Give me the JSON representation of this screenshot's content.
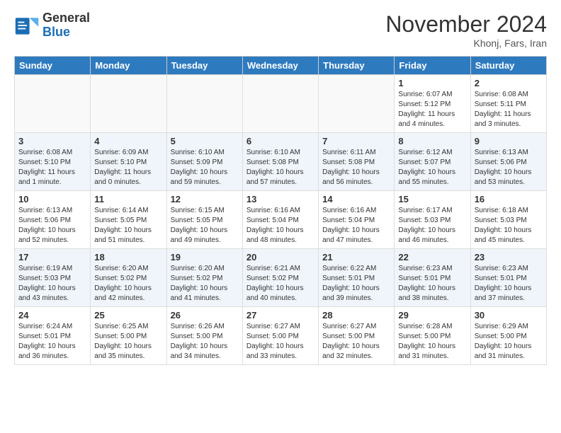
{
  "header": {
    "logo_general": "General",
    "logo_blue": "Blue",
    "month_title": "November 2024",
    "location": "Khonj, Fars, Iran"
  },
  "calendar": {
    "weekdays": [
      "Sunday",
      "Monday",
      "Tuesday",
      "Wednesday",
      "Thursday",
      "Friday",
      "Saturday"
    ],
    "weeks": [
      [
        {
          "day": "",
          "info": ""
        },
        {
          "day": "",
          "info": ""
        },
        {
          "day": "",
          "info": ""
        },
        {
          "day": "",
          "info": ""
        },
        {
          "day": "",
          "info": ""
        },
        {
          "day": "1",
          "info": "Sunrise: 6:07 AM\nSunset: 5:12 PM\nDaylight: 11 hours\nand 4 minutes."
        },
        {
          "day": "2",
          "info": "Sunrise: 6:08 AM\nSunset: 5:11 PM\nDaylight: 11 hours\nand 3 minutes."
        }
      ],
      [
        {
          "day": "3",
          "info": "Sunrise: 6:08 AM\nSunset: 5:10 PM\nDaylight: 11 hours\nand 1 minute."
        },
        {
          "day": "4",
          "info": "Sunrise: 6:09 AM\nSunset: 5:10 PM\nDaylight: 11 hours\nand 0 minutes."
        },
        {
          "day": "5",
          "info": "Sunrise: 6:10 AM\nSunset: 5:09 PM\nDaylight: 10 hours\nand 59 minutes."
        },
        {
          "day": "6",
          "info": "Sunrise: 6:10 AM\nSunset: 5:08 PM\nDaylight: 10 hours\nand 57 minutes."
        },
        {
          "day": "7",
          "info": "Sunrise: 6:11 AM\nSunset: 5:08 PM\nDaylight: 10 hours\nand 56 minutes."
        },
        {
          "day": "8",
          "info": "Sunrise: 6:12 AM\nSunset: 5:07 PM\nDaylight: 10 hours\nand 55 minutes."
        },
        {
          "day": "9",
          "info": "Sunrise: 6:13 AM\nSunset: 5:06 PM\nDaylight: 10 hours\nand 53 minutes."
        }
      ],
      [
        {
          "day": "10",
          "info": "Sunrise: 6:13 AM\nSunset: 5:06 PM\nDaylight: 10 hours\nand 52 minutes."
        },
        {
          "day": "11",
          "info": "Sunrise: 6:14 AM\nSunset: 5:05 PM\nDaylight: 10 hours\nand 51 minutes."
        },
        {
          "day": "12",
          "info": "Sunrise: 6:15 AM\nSunset: 5:05 PM\nDaylight: 10 hours\nand 49 minutes."
        },
        {
          "day": "13",
          "info": "Sunrise: 6:16 AM\nSunset: 5:04 PM\nDaylight: 10 hours\nand 48 minutes."
        },
        {
          "day": "14",
          "info": "Sunrise: 6:16 AM\nSunset: 5:04 PM\nDaylight: 10 hours\nand 47 minutes."
        },
        {
          "day": "15",
          "info": "Sunrise: 6:17 AM\nSunset: 5:03 PM\nDaylight: 10 hours\nand 46 minutes."
        },
        {
          "day": "16",
          "info": "Sunrise: 6:18 AM\nSunset: 5:03 PM\nDaylight: 10 hours\nand 45 minutes."
        }
      ],
      [
        {
          "day": "17",
          "info": "Sunrise: 6:19 AM\nSunset: 5:03 PM\nDaylight: 10 hours\nand 43 minutes."
        },
        {
          "day": "18",
          "info": "Sunrise: 6:20 AM\nSunset: 5:02 PM\nDaylight: 10 hours\nand 42 minutes."
        },
        {
          "day": "19",
          "info": "Sunrise: 6:20 AM\nSunset: 5:02 PM\nDaylight: 10 hours\nand 41 minutes."
        },
        {
          "day": "20",
          "info": "Sunrise: 6:21 AM\nSunset: 5:02 PM\nDaylight: 10 hours\nand 40 minutes."
        },
        {
          "day": "21",
          "info": "Sunrise: 6:22 AM\nSunset: 5:01 PM\nDaylight: 10 hours\nand 39 minutes."
        },
        {
          "day": "22",
          "info": "Sunrise: 6:23 AM\nSunset: 5:01 PM\nDaylight: 10 hours\nand 38 minutes."
        },
        {
          "day": "23",
          "info": "Sunrise: 6:23 AM\nSunset: 5:01 PM\nDaylight: 10 hours\nand 37 minutes."
        }
      ],
      [
        {
          "day": "24",
          "info": "Sunrise: 6:24 AM\nSunset: 5:01 PM\nDaylight: 10 hours\nand 36 minutes."
        },
        {
          "day": "25",
          "info": "Sunrise: 6:25 AM\nSunset: 5:00 PM\nDaylight: 10 hours\nand 35 minutes."
        },
        {
          "day": "26",
          "info": "Sunrise: 6:26 AM\nSunset: 5:00 PM\nDaylight: 10 hours\nand 34 minutes."
        },
        {
          "day": "27",
          "info": "Sunrise: 6:27 AM\nSunset: 5:00 PM\nDaylight: 10 hours\nand 33 minutes."
        },
        {
          "day": "28",
          "info": "Sunrise: 6:27 AM\nSunset: 5:00 PM\nDaylight: 10 hours\nand 32 minutes."
        },
        {
          "day": "29",
          "info": "Sunrise: 6:28 AM\nSunset: 5:00 PM\nDaylight: 10 hours\nand 31 minutes."
        },
        {
          "day": "30",
          "info": "Sunrise: 6:29 AM\nSunset: 5:00 PM\nDaylight: 10 hours\nand 31 minutes."
        }
      ]
    ]
  }
}
